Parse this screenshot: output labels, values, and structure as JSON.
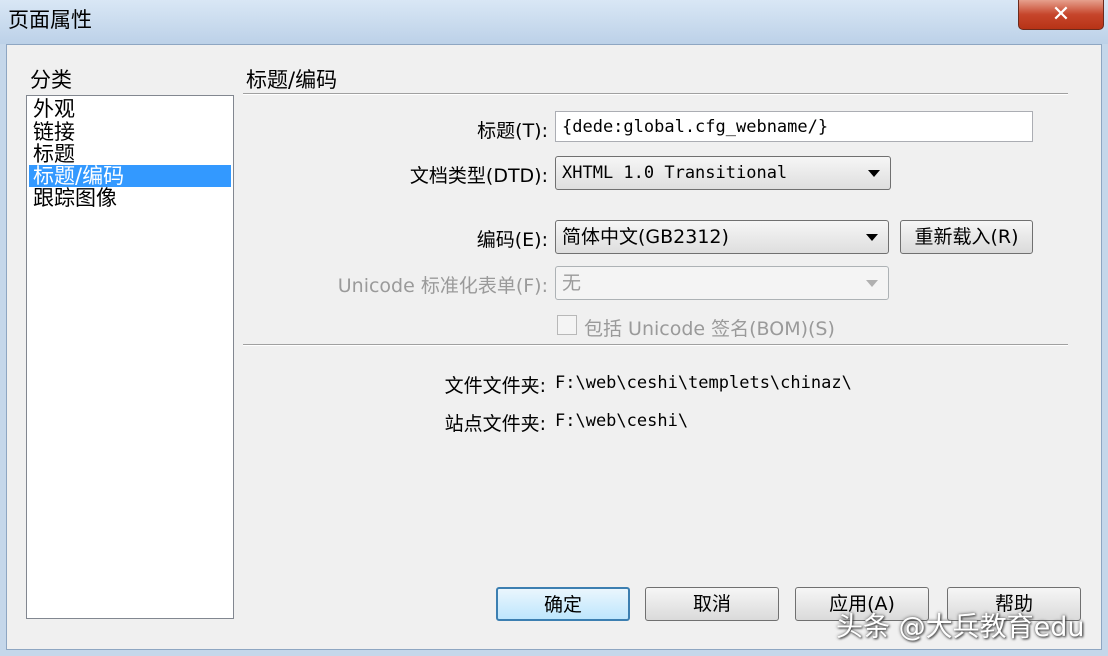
{
  "window": {
    "title": "页面属性",
    "close_glyph": "✕"
  },
  "category": {
    "label": "分类",
    "items": [
      {
        "label": "外观"
      },
      {
        "label": "链接"
      },
      {
        "label": "标题"
      },
      {
        "label": "标题/编码"
      },
      {
        "label": "跟踪图像"
      }
    ],
    "selected": "标题/编码"
  },
  "section": {
    "title": "标题/编码",
    "title_field": {
      "label": "标题(T):",
      "value": "{dede:global.cfg_webname/}"
    },
    "doctype": {
      "label": "文档类型(DTD):",
      "value": "XHTML 1.0 Transitional"
    },
    "encoding": {
      "label": "编码(E):",
      "value": "简体中文(GB2312)",
      "reload_label": "重新载入(R)"
    },
    "unicode_norm": {
      "label": "Unicode 标准化表单(F):",
      "value": "无"
    },
    "bom": {
      "label": "包括 Unicode 签名(BOM)(S)",
      "checked": false
    },
    "file_folder": {
      "label": "文件文件夹:",
      "value": "F:\\web\\ceshi\\templets\\chinaz\\"
    },
    "site_folder": {
      "label": "站点文件夹:",
      "value": "F:\\web\\ceshi\\"
    }
  },
  "buttons": {
    "ok": "确定",
    "cancel": "取消",
    "apply": "应用(A)",
    "help": "帮助"
  },
  "watermark": "头条 @大兵教育edu",
  "colors": {
    "selection": "#3399ff",
    "title_bar": "#c5d7ea",
    "close_button": "#c6452b"
  }
}
